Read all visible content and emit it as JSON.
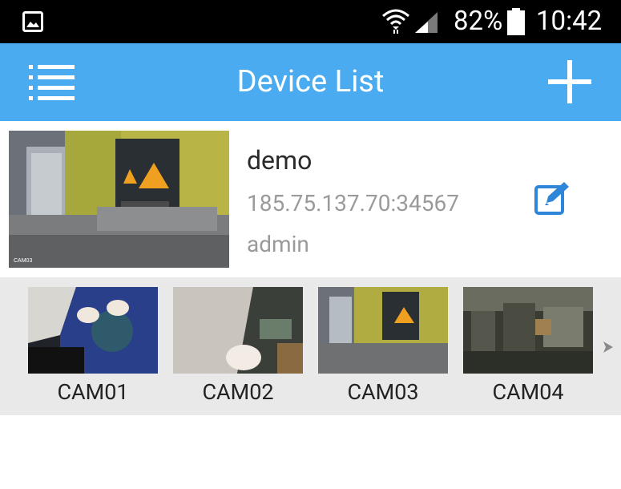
{
  "status_bar": {
    "battery": "82%",
    "time": "10:42"
  },
  "app_bar": {
    "title": "Device List",
    "menu_icon": "list-menu-icon",
    "add_icon": "plus-icon"
  },
  "device": {
    "name": "demo",
    "address": "185.75.137.70:34567",
    "user": "admin",
    "edit_icon": "edit-icon"
  },
  "channels": [
    {
      "label": "CAM01"
    },
    {
      "label": "CAM02"
    },
    {
      "label": "CAM03"
    },
    {
      "label": "CAM04"
    }
  ],
  "colors": {
    "app_bar": "#4aabf0",
    "strip_background": "#e9e9e9",
    "accent": "#2f86d8"
  }
}
